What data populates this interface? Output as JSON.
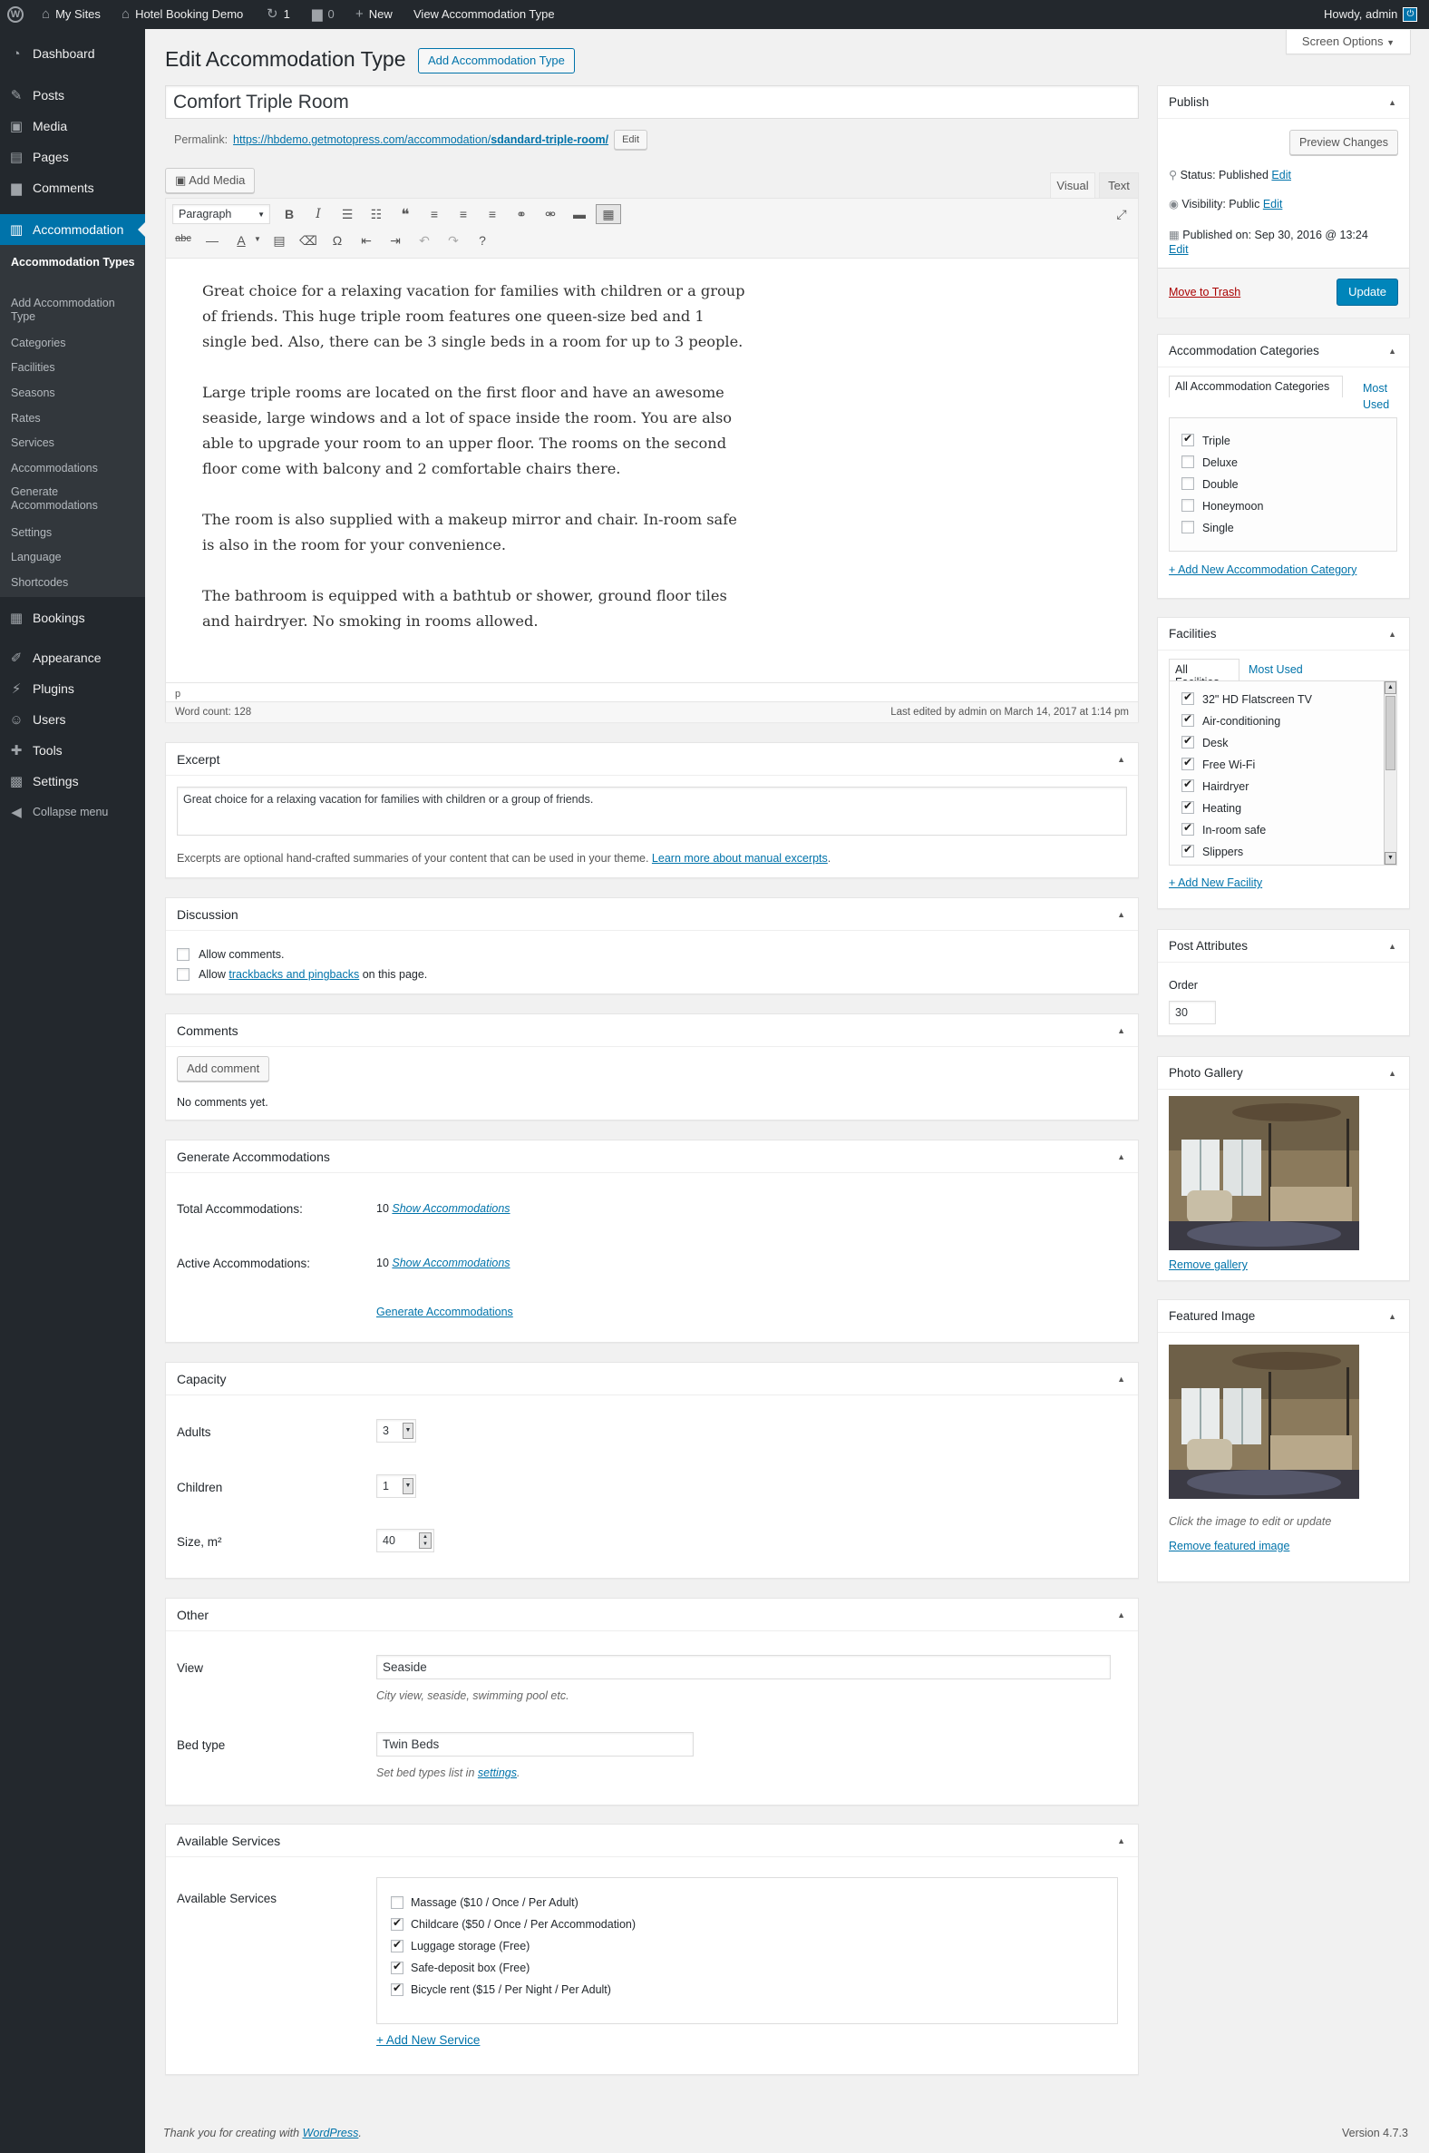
{
  "adminbar": {
    "my_sites": "My Sites",
    "site": "Hotel Booking Demo",
    "updates": "1",
    "comments": "0",
    "new": "New",
    "view": "View Accommodation Type",
    "howdy": "Howdy, admin"
  },
  "menu": {
    "dashboard": "Dashboard",
    "posts": "Posts",
    "media": "Media",
    "pages": "Pages",
    "comments": "Comments",
    "accommodation": "Accommodation",
    "sub": [
      "Accommodation Types",
      "Add Accommodation Type",
      "Categories",
      "Facilities",
      "Seasons",
      "Rates",
      "Services",
      "Accommodations",
      "Generate Accommodations",
      "Settings",
      "Language",
      "Shortcodes"
    ],
    "bookings": "Bookings",
    "appearance": "Appearance",
    "plugins": "Plugins",
    "users": "Users",
    "tools": "Tools",
    "settings": "Settings",
    "collapse": "Collapse menu"
  },
  "screen_options": "Screen Options",
  "page_title": "Edit Accommodation Type",
  "add_new": "Add Accommodation Type",
  "post_title": "Comfort Triple Room",
  "permalink": {
    "label": "Permalink:",
    "base": "https://hbdemo.getmotopress.com/accommodation/",
    "slug": "sdandard-triple-room/",
    "edit": "Edit"
  },
  "editor": {
    "add_media": "Add Media",
    "tab_visual": "Visual",
    "tab_text": "Text",
    "format": "Paragraph",
    "paragraphs": [
      "Great choice for a relaxing vacation for families with children or a group of friends. This huge triple room features one queen-size bed and 1 single bed. Also, there can be 3 single beds in a room for up to 3 people.",
      "Large triple rooms are located on the first floor and have an awesome seaside, large windows and a lot of space inside the room. You are also able to upgrade your room to an upper floor. The rooms on the second floor come with balcony and 2 comfortable chairs there.",
      "The room is also supplied with a makeup mirror and chair. In-room safe is also in the room for your convenience.",
      "The bathroom is equipped with a bathtub or shower, ground floor tiles and hairdryer. No smoking in rooms allowed."
    ],
    "path": "p",
    "word_count": "Word count: 128",
    "last_edited": "Last edited by admin on March 14, 2017 at 1:14 pm"
  },
  "excerpt": {
    "title": "Excerpt",
    "text": "Great choice for a relaxing vacation for families with children or a group of friends.",
    "help": "Excerpts are optional hand-crafted summaries of your content that can be used in your theme.",
    "link": "Learn more about manual excerpts",
    "dot": "."
  },
  "discussion": {
    "title": "Discussion",
    "allow_comments": "Allow comments.",
    "allow": "Allow",
    "trackbacks": "trackbacks and pingbacks",
    "on_page": "on this page."
  },
  "comments_box": {
    "title": "Comments",
    "add": "Add comment",
    "none": "No comments yet."
  },
  "generate": {
    "title": "Generate Accommodations",
    "total_label": "Total Accommodations:",
    "total": "10",
    "active_label": "Active Accommodations:",
    "active": "10",
    "show": "Show Accommodations",
    "generate": "Generate Accommodations"
  },
  "capacity": {
    "title": "Capacity",
    "adults_label": "Adults",
    "adults": "3",
    "children_label": "Children",
    "children": "1",
    "size_label": "Size, m²",
    "size": "40"
  },
  "other": {
    "title": "Other",
    "view_label": "View",
    "view": "Seaside",
    "view_help": "City view, seaside, swimming pool etc.",
    "bed_label": "Bed type",
    "bed": "Twin Beds",
    "bed_help": "Set bed types list in",
    "bed_link": "settings",
    "dot": "."
  },
  "services": {
    "title": "Available Services",
    "label": "Available Services",
    "items": [
      {
        "name": "Massage ($10 / Once / Per Adult)",
        "checked": false
      },
      {
        "name": "Childcare ($50 / Once / Per Accommodation)",
        "checked": true
      },
      {
        "name": "Luggage storage (Free)",
        "checked": true
      },
      {
        "name": "Safe-deposit box (Free)",
        "checked": true
      },
      {
        "name": "Bicycle rent ($15 / Per Night / Per Adult)",
        "checked": true
      }
    ],
    "add": "+ Add New Service"
  },
  "publish": {
    "title": "Publish",
    "preview": "Preview Changes",
    "status": "Status: Published",
    "visibility": "Visibility: Public",
    "published": "Published on: Sep 30, 2016 @ 13:24",
    "edit": "Edit",
    "trash": "Move to Trash",
    "update": "Update"
  },
  "categories": {
    "title": "Accommodation Categories",
    "tab_all": "All Accommodation Categories",
    "tab_most": "Most Used",
    "items": [
      {
        "name": "Triple",
        "checked": true
      },
      {
        "name": "Deluxe",
        "checked": false
      },
      {
        "name": "Double",
        "checked": false
      },
      {
        "name": "Honeymoon",
        "checked": false
      },
      {
        "name": "Single",
        "checked": false
      }
    ],
    "add": "+ Add New Accommodation Category"
  },
  "facilities": {
    "title": "Facilities",
    "tab_all": "All Facilities",
    "tab_most": "Most Used",
    "items": [
      "32\" HD Flatscreen TV",
      "Air-conditioning",
      "Desk",
      "Free Wi-Fi",
      "Hairdryer",
      "Heating",
      "In-room safe",
      "Slippers"
    ],
    "add": "+ Add New Facility"
  },
  "attributes": {
    "title": "Post Attributes",
    "order_label": "Order",
    "order": "30"
  },
  "gallery": {
    "title": "Photo Gallery",
    "remove": "Remove gallery"
  },
  "featured": {
    "title": "Featured Image",
    "hint": "Click the image to edit or update",
    "remove": "Remove featured image"
  },
  "footer": {
    "thanks": "Thank you for creating with",
    "wp": "WordPress",
    "dot": ".",
    "version": "Version 4.7.3"
  }
}
